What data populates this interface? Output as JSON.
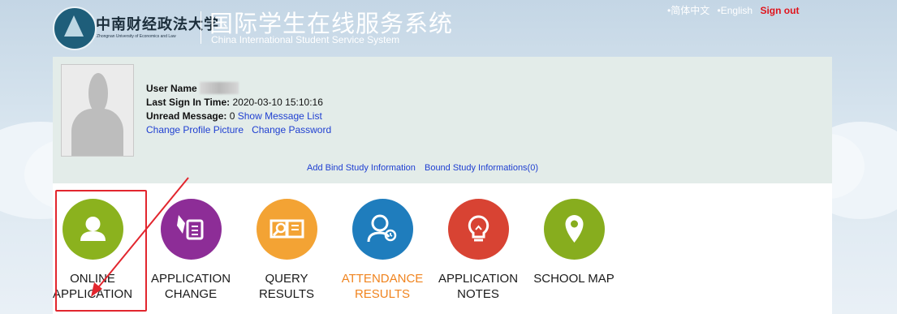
{
  "header": {
    "logo_cn": "中南财经政法大学",
    "logo_en": "Zhongnan University of Economics and Law",
    "system_title_cn": "国际学生在线服务系统",
    "system_title_en": "China International Student Service System"
  },
  "top_links": {
    "simplified_chinese": "•简体中文",
    "english": "•English",
    "sign_out": "Sign out"
  },
  "user": {
    "name_label": "User Name",
    "last_signin_label": "Last Sign In Time:",
    "last_signin_value": "2020-03-10 15:10:16",
    "unread_label": "Unread Message:",
    "unread_count": "0",
    "show_message_list": "Show Message List",
    "change_profile_picture": "Change Profile Picture",
    "change_password": "Change Password",
    "add_bind_study": "Add Bind Study Information",
    "bound_study": "Bound Study Informations(0)"
  },
  "tiles": [
    {
      "line1": "ONLINE",
      "line2": "APPLICATION",
      "color": "#8bb21e",
      "icon": "user-icon"
    },
    {
      "line1": "APPLICATION",
      "line2": "CHANGE",
      "color": "#8d2d97",
      "icon": "edit-document-icon"
    },
    {
      "line1": "QUERY",
      "line2": "RESULTS",
      "color": "#f3a334",
      "icon": "search-document-icon"
    },
    {
      "line1": "ATTENDANCE",
      "line2": "RESULTS",
      "color": "#1f7dbd",
      "icon": "attendance-person-icon"
    },
    {
      "line1": "APPLICATION",
      "line2": "NOTES",
      "color": "#d84333",
      "icon": "lightbulb-icon"
    },
    {
      "line1": "SCHOOL MAP",
      "line2": "",
      "color": "#87ad1e",
      "icon": "map-pin-icon"
    }
  ]
}
